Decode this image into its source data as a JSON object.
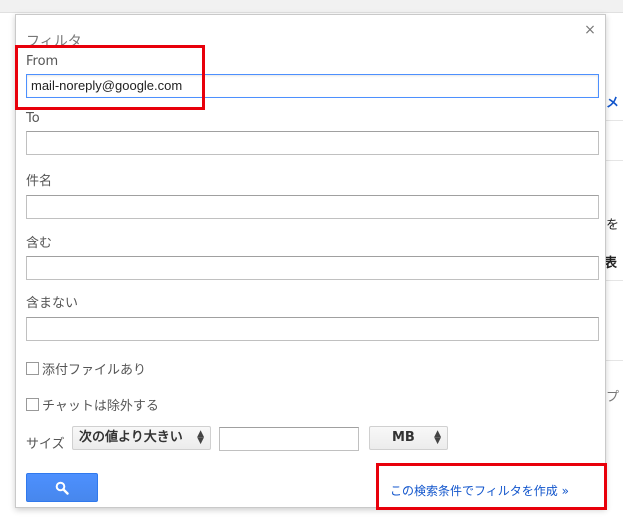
{
  "dialog": {
    "title": "フィルタ",
    "close_glyph": "×",
    "from": {
      "label": "From",
      "value": "mail-noreply@google.com"
    },
    "to": {
      "label": "To",
      "value": ""
    },
    "subject": {
      "label": "件名",
      "value": ""
    },
    "has_words": {
      "label": "含む",
      "value": ""
    },
    "doesnt_have": {
      "label": "含まない",
      "value": ""
    },
    "has_attachment": {
      "label": "添付ファイルあり",
      "checked": false
    },
    "exclude_chats": {
      "label": "チャットは除外する",
      "checked": false
    },
    "size": {
      "label": "サイズ",
      "comparator": "次の値より大きい",
      "value": "",
      "unit": "MB"
    },
    "search_button_icon": "search-icon",
    "create_filter_link": "この検索条件でフィルタを作成 »"
  },
  "background_fragments": {
    "frag1": "メ",
    "frag2": "を",
    "frag3": "表",
    "frag4": "プ"
  },
  "colors": {
    "highlight": "#e8000b",
    "link": "#1155cc",
    "button": "#4d90fe"
  }
}
